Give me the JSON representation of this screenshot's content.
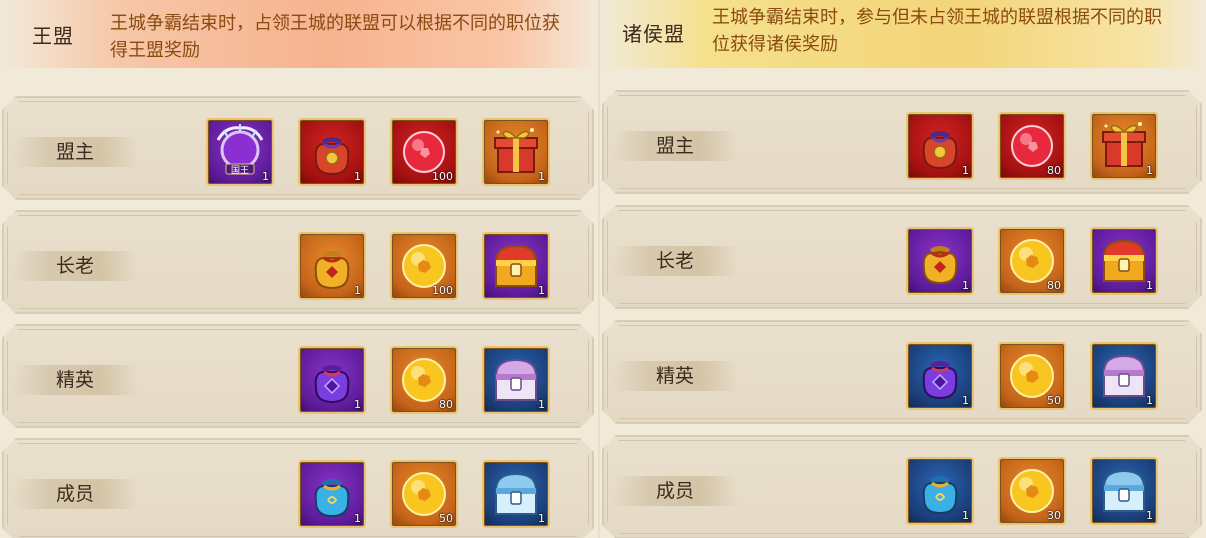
{
  "left": {
    "title": "王盟",
    "description": "王城争霸结束时，占领王城的联盟可以根据不同的职位获得王盟奖励",
    "rows": [
      {
        "label": "盟主",
        "items": [
          {
            "icon": "gift-box-icon",
            "bg": "orange",
            "qty": "1"
          },
          {
            "icon": "red-orb-icon",
            "bg": "red",
            "qty": "100"
          },
          {
            "icon": "red-pouch-icon",
            "bg": "red",
            "qty": "1"
          },
          {
            "icon": "king-avatar-frame-icon",
            "bg": "purple",
            "qty": "1",
            "badge": "国王"
          }
        ]
      },
      {
        "label": "长老",
        "items": [
          {
            "icon": "gold-chest-icon",
            "bg": "purple",
            "qty": "1"
          },
          {
            "icon": "gold-orb-icon",
            "bg": "orange",
            "qty": "100"
          },
          {
            "icon": "gold-pouch-icon",
            "bg": "orange",
            "qty": "1"
          }
        ]
      },
      {
        "label": "精英",
        "items": [
          {
            "icon": "silver-chest-icon",
            "bg": "blue",
            "qty": "1"
          },
          {
            "icon": "gold-orb-icon",
            "bg": "orange",
            "qty": "80"
          },
          {
            "icon": "purple-pouch-icon",
            "bg": "purple",
            "qty": "1"
          }
        ]
      },
      {
        "label": "成员",
        "items": [
          {
            "icon": "blue-chest-icon",
            "bg": "blue",
            "qty": "1"
          },
          {
            "icon": "gold-orb-icon",
            "bg": "orange",
            "qty": "50"
          },
          {
            "icon": "blue-pouch-icon",
            "bg": "purple",
            "qty": "1"
          }
        ]
      }
    ]
  },
  "right": {
    "title": "诸侯盟",
    "description": "王城争霸结束时，参与但未占领王城的联盟根据不同的职位获得诸侯奖励",
    "rows": [
      {
        "label": "盟主",
        "items": [
          {
            "icon": "gift-box-icon",
            "bg": "orange",
            "qty": "1"
          },
          {
            "icon": "red-orb-icon",
            "bg": "red",
            "qty": "80"
          },
          {
            "icon": "red-pouch-icon",
            "bg": "red",
            "qty": "1"
          }
        ]
      },
      {
        "label": "长老",
        "items": [
          {
            "icon": "gold-chest-icon",
            "bg": "purple",
            "qty": "1"
          },
          {
            "icon": "gold-orb-icon",
            "bg": "orange",
            "qty": "80"
          },
          {
            "icon": "gold-pouch-icon",
            "bg": "purple",
            "qty": "1"
          }
        ]
      },
      {
        "label": "精英",
        "items": [
          {
            "icon": "silver-chest-icon",
            "bg": "blue",
            "qty": "1"
          },
          {
            "icon": "gold-orb-icon",
            "bg": "orange",
            "qty": "50"
          },
          {
            "icon": "purple-pouch-icon",
            "bg": "blue",
            "qty": "1"
          }
        ]
      },
      {
        "label": "成员",
        "items": [
          {
            "icon": "blue-chest-icon",
            "bg": "blue",
            "qty": "1"
          },
          {
            "icon": "gold-orb-icon",
            "bg": "orange",
            "qty": "30"
          },
          {
            "icon": "blue-pouch-icon",
            "bg": "blue",
            "qty": "1"
          }
        ]
      }
    ]
  },
  "colors": {
    "title_text": "#3d2b1d",
    "description_text": "#8b4a10",
    "left_header_band": "#f7b390",
    "right_header_band": "#f3d57a",
    "item_border": "#e9c36d"
  }
}
